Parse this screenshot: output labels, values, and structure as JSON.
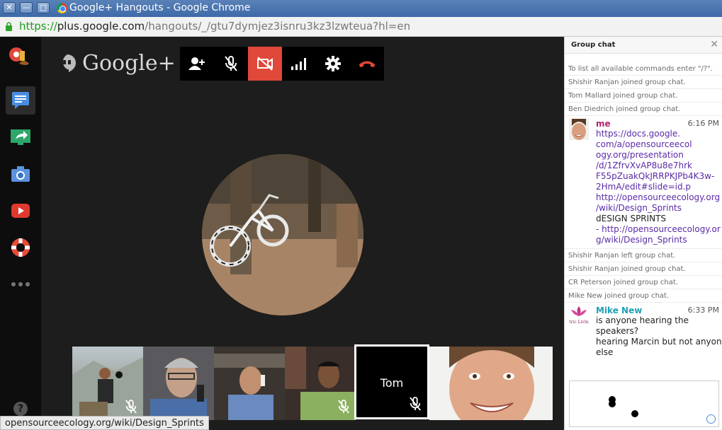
{
  "window": {
    "title": "Google+ Hangouts - Google Chrome",
    "close_glyph": "✕",
    "minimize_glyph": "—",
    "maximize_glyph": "▢"
  },
  "address_bar": {
    "scheme": "https://",
    "host": "plus.google.com",
    "path": "/hangouts/_/gtu7dymjez3isnru3kz3lzwteua?hl=en"
  },
  "brand": {
    "logo_text": "Google+"
  },
  "rail": {
    "items": [
      "effects-icon",
      "chat-icon",
      "screenshare-icon",
      "camera-icon",
      "youtube-icon",
      "help-lifebuoy-icon",
      "more-icon"
    ],
    "help_glyph": "?"
  },
  "toolbar": {
    "items": [
      "invite-icon",
      "mute-mic-icon",
      "camera-off-icon",
      "bandwidth-icon",
      "settings-icon",
      "hangup-icon"
    ],
    "active_color": "#e0483a"
  },
  "participants": [
    {
      "name": "",
      "muted": true
    },
    {
      "name": "",
      "muted": false
    },
    {
      "name": "",
      "muted": false
    },
    {
      "name": "",
      "muted": true
    },
    {
      "name": "Tom",
      "muted": true,
      "selected": true
    },
    {
      "name": "",
      "muted": false
    }
  ],
  "chat": {
    "header": "Group chat",
    "close_glyph": "✕",
    "system_top": [
      "To list all available commands enter \"/?\".",
      "Shishir Ranjan joined group chat.",
      "Tom Mallard joined group chat.",
      "Ben Diedrich joined group chat."
    ],
    "msg1": {
      "name": "me",
      "time": "6:16 PM",
      "lines": [
        "https://docs.google.",
        "com/a/opensourceecol",
        "ogy.org/presentation",
        "/d/1ZfrvXvAP8u8e7hrk",
        "F55pZuakQkJRRPKJPb4K3w-",
        "2HmA/edit#slide=id.p",
        "http://opensourceecology.org",
        "/wiki/Design_Sprints",
        "dESIGN SPRINTS",
        "- http://opensourceecology.or",
        "g/wiki/Design_Sprints"
      ]
    },
    "system_mid": [
      "Shishir Ranjan left group chat.",
      "Shishir Ranjan joined group chat.",
      "CR Peterson joined group chat.",
      "Mike New joined group chat."
    ],
    "msg2": {
      "name": "Mike New",
      "time": "6:33 PM",
      "avatar_caption": "tric Livin",
      "lines": [
        "is anyone hearing the",
        "speakers?",
        "hearing Marcin but not anyone",
        "else"
      ]
    }
  },
  "statusbar": {
    "text": "opensourceecology.org/wiki/Design_Sprints"
  },
  "colors": {
    "me_name": "#b0256d",
    "mike_name": "#1e9fb5",
    "link": "#5a2aa8"
  }
}
